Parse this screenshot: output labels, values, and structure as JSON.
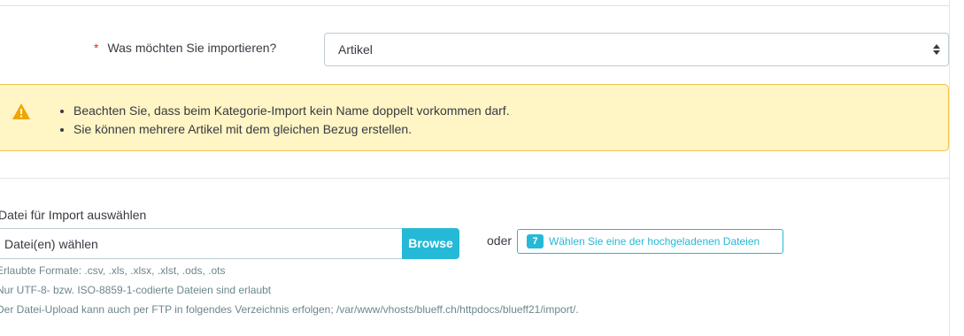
{
  "import_type": {
    "required_marker": "*",
    "label": "Was möchten Sie importieren?",
    "selected_value": "Artikel"
  },
  "alert": {
    "type": "warning",
    "items": [
      "Beachten Sie, dass beim Kategorie-Import kein Name doppelt vorkommen darf.",
      "Sie können mehrere Artikel mit dem gleichen Bezug erstellen."
    ]
  },
  "file_upload": {
    "title": "Datei für Import auswählen",
    "input_placeholder": "Datei(en) wählen",
    "browse_label": "Browse",
    "or_label": "oder",
    "uploaded_count": "7",
    "uploaded_label": "Wählen Sie eine der hochgeladenen Dateien",
    "help_lines": [
      "Erlaubte Formate: .csv, .xls, .xlsx, .xlst, .ods, .ots",
      "Nur UTF-8- bzw. ISO-8859-1-codierte Dateien sind erlaubt",
      "Der Datei-Upload kann auch per FTP in folgendes Verzeichnis erfolgen; /var/www/vhosts/blueff.ch/httpdocs/blueff21/import/."
    ]
  },
  "colors": {
    "accent": "#25b9d7",
    "warning_bg": "#fff5c5",
    "warning_border": "#f0c34d",
    "warning_icon": "#f0a500",
    "required": "#c0392b"
  }
}
